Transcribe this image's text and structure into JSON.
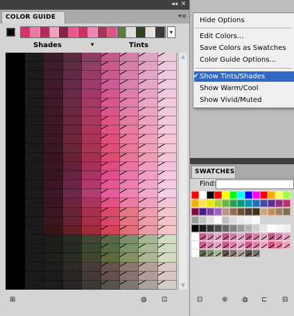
{
  "color_guide": {
    "title": "COLOR GUIDE",
    "collapse_glyph": "◂◂",
    "close_glyph": "✕",
    "menu_glyph": "▾≡",
    "dropdown_glyph": "▾",
    "column_headers": {
      "shades": "Shades",
      "tints": "Tints",
      "mid_marker": "▾"
    },
    "harmony_colors": [
      "#d2346e",
      "#e47ca6",
      "#b12a5b",
      "#f2a0c2",
      "#8a2046",
      "#e9578e",
      "#cc2f67",
      "#ef86b1",
      "#a7345b",
      "#d9558a",
      "#5f7a45",
      "#dedede",
      "#2e4220",
      "#e8e0e0",
      "#3a3a3a"
    ],
    "shade_rows": [
      [
        "#1c1c1c",
        "#3a1d29",
        "#5a2b40",
        "#8a3f60",
        "#c05a87",
        "#d07fa3",
        "#dea3bf",
        "#ecc9d9"
      ],
      [
        "#1b1c1c",
        "#3d1c2b",
        "#5f2a44",
        "#913e66",
        "#c55b8c",
        "#d480a8",
        "#e0a4c2",
        "#edcadb"
      ],
      [
        "#1c1c1c",
        "#3f1b2c",
        "#642945",
        "#983c68",
        "#cb5a8f",
        "#d87fab",
        "#e3a4c5",
        "#efc9dd"
      ],
      [
        "#1c1c1c",
        "#401a2c",
        "#682a48",
        "#9e3c6c",
        "#d05a93",
        "#dc80ae",
        "#e6a5c7",
        "#f0cadf"
      ],
      [
        "#1c1c1c",
        "#401a2b",
        "#6a2946",
        "#a23a6b",
        "#d45792",
        "#df7dad",
        "#e8a3c6",
        "#f1c8de"
      ],
      [
        "#1b1b1c",
        "#401929",
        "#6b2944",
        "#a53a66",
        "#d8578e",
        "#e27eaa",
        "#eaa4c4",
        "#f2c9dd"
      ],
      [
        "#1b1b1b",
        "#3f1928",
        "#6c2842",
        "#a83963",
        "#db568b",
        "#e57ea8",
        "#eca4c3",
        "#f3c9dc"
      ],
      [
        "#1b1b1b",
        "#3e1826",
        "#6d273f",
        "#aa375e",
        "#dd5485",
        "#e67ca3",
        "#eda2bf",
        "#f3c8da"
      ],
      [
        "#1b1b1b",
        "#3e1725",
        "#6c273d",
        "#ab365a",
        "#df5381",
        "#e87ba0",
        "#eea1bd",
        "#f4c7d9"
      ],
      [
        "#1b1b1b",
        "#3d1623",
        "#6b263a",
        "#aa3456",
        "#e0507c",
        "#e9789c",
        "#eea0ba",
        "#f4c6d7"
      ],
      [
        "#1b1b1b",
        "#3c1522",
        "#6a2537",
        "#a93352",
        "#e04f78",
        "#e97799",
        "#ef9fb8",
        "#f4c5d6"
      ],
      [
        "#1b1b1b",
        "#3a1420",
        "#672334",
        "#a6314e",
        "#de4c73",
        "#e87595",
        "#ee9db5",
        "#f4c4d4"
      ],
      [
        "#1b1b1b",
        "#3a1420",
        "#66223d",
        "#a5305a",
        "#de4b85",
        "#e874a2",
        "#ee9cbf",
        "#f4c3db"
      ],
      [
        "#1b1b1b",
        "#3b1423",
        "#692441",
        "#a93464",
        "#e14f8f",
        "#ea77aa",
        "#ef9fc4",
        "#f5c6de"
      ],
      [
        "#1b1b1b",
        "#3c1624",
        "#6c2746",
        "#ad3a6b",
        "#e45796",
        "#ec7fb0",
        "#f1a5c9",
        "#f6cae1"
      ],
      [
        "#1b1b1b",
        "#3d1726",
        "#6e2949",
        "#b03e71",
        "#e75c9c",
        "#ee84b4",
        "#f2a9cb",
        "#f6cde2"
      ],
      [
        "#1b1b1b",
        "#3d1624",
        "#6d2640",
        "#ab365d",
        "#e05384",
        "#e97ba0",
        "#eea1bd",
        "#f4c7d8"
      ],
      [
        "#1b1b1b",
        "#3c1520",
        "#6a2436",
        "#a7314c",
        "#dc4a6b",
        "#e77487",
        "#ee9dab",
        "#f4c5cc"
      ],
      [
        "#1b1b1b",
        "#3b1520",
        "#682333",
        "#a42f47",
        "#d84763",
        "#e57282",
        "#ec9ca6",
        "#f3c4c9"
      ],
      [
        "#1b1b1b",
        "#391417",
        "#661f29",
        "#a22b3d",
        "#d54257",
        "#e36e7b",
        "#eb9aa2",
        "#f3c3c6"
      ],
      [
        "#1b1b1b",
        "#1e1f1c",
        "#282b24",
        "#3f4635",
        "#5a6a48",
        "#7f8f6e",
        "#a8b597",
        "#d1dac3"
      ],
      [
        "#1b1b1b",
        "#1d1f1b",
        "#252b22",
        "#3a4632",
        "#556b43",
        "#7a9068",
        "#a5b693",
        "#cfdbc0"
      ],
      [
        "#1b1b1b",
        "#1e1e1b",
        "#2a2b22",
        "#424630",
        "#5f6b3f",
        "#849064",
        "#adb690",
        "#d4dbbd"
      ],
      [
        "#1b1b1b",
        "#1e1d1c",
        "#2d2826",
        "#473c38",
        "#67544e",
        "#8c7770",
        "#b49f98",
        "#d8c9c4"
      ],
      [
        "#1b1b1b",
        "#1d1c1c",
        "#2b2626",
        "#453838",
        "#654f4f",
        "#8a7272",
        "#b29b9b",
        "#d7c6c6"
      ],
      [
        "#1b1b1b",
        "#1c1c1b",
        "#272624",
        "#3d3a36",
        "#58534c",
        "#7d7870",
        "#a7a29a",
        "#d1cdc7"
      ]
    ]
  },
  "flyout_menu": {
    "items": [
      {
        "label": "Hide Options",
        "selected": false,
        "checked": false
      },
      {
        "label": "Edit Colors...",
        "selected": false,
        "checked": false
      },
      {
        "label": "Save Colors as Swatches",
        "selected": false,
        "checked": false
      },
      {
        "label": "Color Guide Options...",
        "selected": false,
        "checked": false
      },
      {
        "label": "Show Tints/Shades",
        "selected": true,
        "checked": true
      },
      {
        "label": "Show Warm/Cool",
        "selected": false,
        "checked": false
      },
      {
        "label": "Show Vivid/Muted",
        "selected": false,
        "checked": false
      }
    ],
    "check_glyph": "✔"
  },
  "swatches": {
    "title": "SWATCHES",
    "find_label": "Find:",
    "find_value": "",
    "rows": [
      [
        "#ff0000",
        "#ffffff",
        "#000000",
        "#ff0000",
        "#ffff00",
        "#00ff00",
        "#00ffff",
        "#0000ff",
        "#ff00ff",
        "#ff0000",
        "#ffaa00",
        "#ffff66",
        "#a0ff3c"
      ],
      [
        "#f7b000",
        "#ffe14d",
        "#e8e800",
        "#b3cc33",
        "#6fb43f",
        "#2f9e4a",
        "#009c7a",
        "#0097b7",
        "#1f6fb7",
        "#3f4b9f",
        "#5f2f8f",
        "#8f2f7f",
        "#bf2f6f"
      ],
      [
        "#7f0f3f",
        "#3f1f7f",
        "#7f3f9f",
        "#9f5fbf",
        "#bf8f7f",
        "#8f6f4f",
        "#6f4f2f",
        "#4f3f2f",
        "#3f2f1f",
        "#cfa57f",
        "#bf8f5f",
        "#9f7f5f",
        "#7f6f4f"
      ],
      [
        "#9c9c9c",
        "#c0c0c0",
        "#e0e0e0",
        "#ffffff",
        "#bdbdbd",
        "#d9d9d9",
        "#e8e8e8",
        "#f0f0f0",
        "#fafafa"
      ],
      [
        "#000000",
        "#1a1a1a",
        "#333333",
        "#4d4d4d",
        "#666666",
        "#808080",
        "#999999",
        "#b3b3b3",
        "#cccccc",
        "#e6e6e6",
        "#ffffff",
        "#f5f5f5",
        "#eeeeee"
      ],
      [
        "#ffffff",
        "#c05a87",
        "#d07fa3",
        "#dea3bf",
        "#c05a87",
        "#d07fa3",
        "#dea3bf",
        "#c05a87",
        "#d07fa3",
        "#dea3bf",
        "#c05a87",
        "#d07fa3",
        "#dea3bf"
      ],
      [
        "#ffffff",
        "#cb5a8f",
        "#d87fab",
        "#e3a4c5",
        "#d45792",
        "#df7dad",
        "#e8a3c6",
        "#db568b",
        "#e57ea8",
        "#eca4c3",
        "#e04f78",
        "#e97799",
        "#ef9fb8"
      ],
      [
        "#ffffff",
        "#5a6a48",
        "#7f8f6e",
        "#a8b597",
        "#67544e",
        "#8c7770",
        "#b49f98",
        "#58534c",
        "#7d7870"
      ]
    ]
  }
}
